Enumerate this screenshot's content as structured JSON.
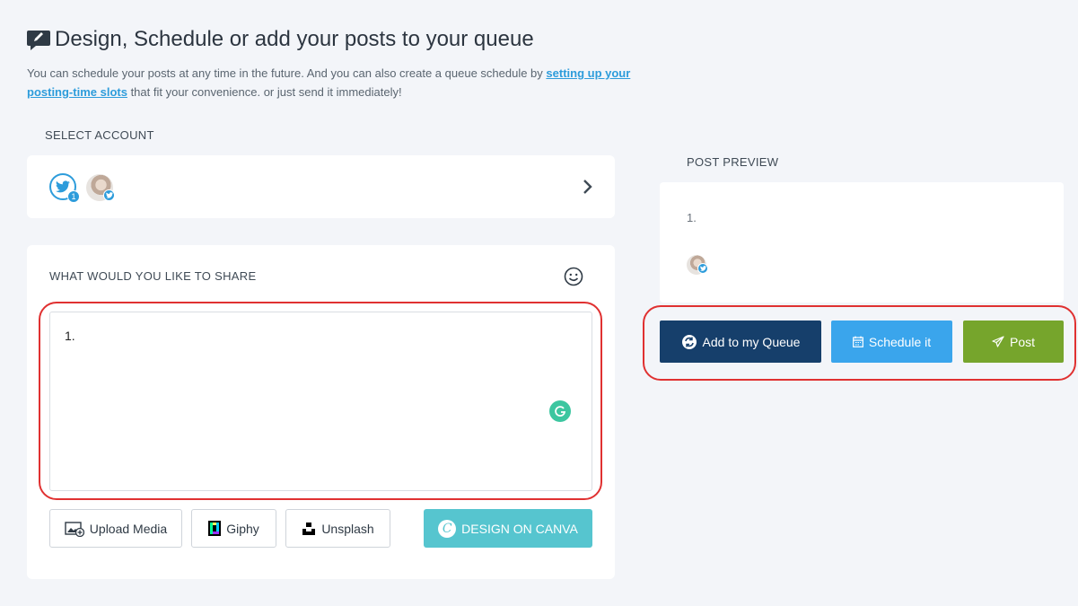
{
  "page": {
    "title": "Design, Schedule or add your posts to your queue",
    "intro_before_link": "You can schedule your posts at any time in the future. And you can also create a queue schedule by ",
    "intro_link": "setting up your posting-time slots",
    "intro_after_link": " that fit your convenience. or just send it immediately!"
  },
  "select_account": {
    "label": "SELECT ACCOUNT",
    "twitter_count": "1"
  },
  "composer": {
    "label": "WHAT WOULD YOU LIKE TO SHARE",
    "text": "1.",
    "buttons": {
      "upload_media": "Upload Media",
      "giphy": "Giphy",
      "unsplash": "Unsplash",
      "canva": "DESIGN ON CANVA"
    }
  },
  "preview": {
    "label": "POST PREVIEW",
    "text": "1."
  },
  "actions": {
    "queue": "Add to my Queue",
    "schedule": "Schedule it",
    "post": "Post"
  },
  "colors": {
    "queue": "#163f6b",
    "schedule": "#3aa5ec",
    "post": "#76a52c",
    "highlight": "#e03131",
    "twitter": "#2d9cdb",
    "canva": "#56c5cf"
  },
  "icons": [
    "compose-icon",
    "twitter-icon",
    "chevron-right-icon",
    "smiley-icon",
    "grammarly-icon",
    "image-add-icon",
    "giphy-icon",
    "unsplash-icon",
    "canva-icon",
    "queue-sync-icon",
    "calendar-icon",
    "send-icon"
  ]
}
